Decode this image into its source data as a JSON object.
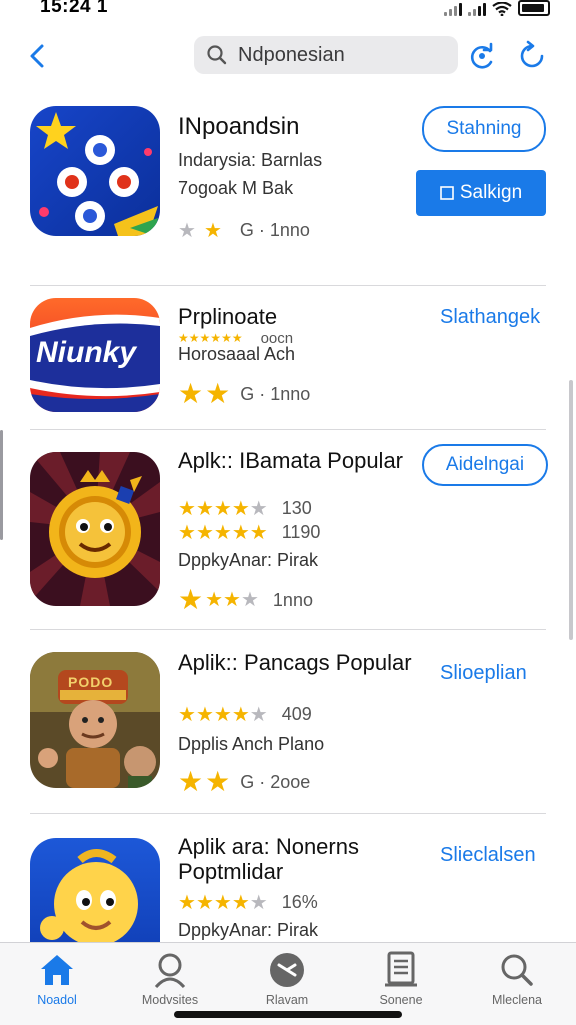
{
  "status_bar": {
    "time": "15:24 1"
  },
  "search": {
    "value": "Ndponesian"
  },
  "apps": [
    {
      "title": "INpoandsin",
      "subtitles": [
        "Indarysia: Barnlas",
        "7ogoak M Bak"
      ],
      "rating_stars": 2,
      "rating_text": "G · 1nno",
      "buttons": {
        "outline": "Stahning",
        "solid": "Salkign"
      }
    },
    {
      "title": "Prplinoate",
      "stars_text": "oocn",
      "subtitles": [
        "Horosaaal Ach"
      ],
      "rating_text": "G · 1nno",
      "button": "Slathangek",
      "icon_text": "Niunky"
    },
    {
      "title": "Aplk:: IBamata Popular",
      "rating_rows": [
        {
          "stars": 4,
          "text": "130"
        },
        {
          "stars": 5,
          "text": "1190"
        }
      ],
      "subtitles": [
        "DppkyAnar: Pirak"
      ],
      "rating_text": "1nno",
      "button": "Aidelngai"
    },
    {
      "title": "Aplik:: Pancags Popular",
      "rating_rows": [
        {
          "stars": 4,
          "text": "409"
        }
      ],
      "subtitles": [
        "Dpplis Anch Plano"
      ],
      "rating_text": "G · 2ooe",
      "button": "Slioeplian",
      "icon_text": "PODO"
    },
    {
      "title": "Aplik ara: Nonerns Poptmlidar",
      "rating_rows": [
        {
          "stars": 4,
          "text": "16%"
        }
      ],
      "subtitles": [
        "DppkyAnar: Pirak"
      ],
      "button": "Slieclalsen"
    }
  ],
  "tabs": [
    {
      "label": "Noadol",
      "active": true
    },
    {
      "label": "Modvsites",
      "active": false
    },
    {
      "label": "Rlavam",
      "active": false
    },
    {
      "label": "Sonene",
      "active": false
    },
    {
      "label": "Mleclena",
      "active": false
    }
  ],
  "colors": {
    "accent": "#1a7ae8",
    "star": "#f5b400",
    "divider": "#d9d9dc"
  }
}
